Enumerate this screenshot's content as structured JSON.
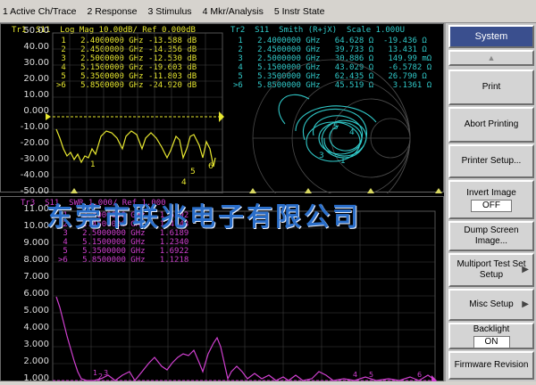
{
  "menubar": {
    "items": [
      "1 Active Ch/Trace",
      "2 Response",
      "3 Stimulus",
      "4 Mkr/Analysis",
      "5 Instr State"
    ]
  },
  "trace1": {
    "header": "Tr1  S11  Log Mag 10.00dB/ Ref 0.000dB",
    "markers": [
      " 1   2.4000000 GHz -13.588 dB",
      " 2   2.4500000 GHz -14.356 dB",
      " 3   2.5000000 GHz -12.530 dB",
      " 4   5.1500000 GHz -19.603 dB",
      " 5   5.3500000 GHz -11.803 dB",
      ">6   5.8500000 GHz -24.920 dB"
    ],
    "yticks": [
      "50.00",
      "40.00",
      "30.00",
      "20.00",
      "10.00",
      "0.000",
      "-10.00",
      "-20.00",
      "-30.00",
      "-40.00",
      "-50.00"
    ]
  },
  "trace2": {
    "header": "Tr2  S11  Smith (R+jX)  Scale 1.000U",
    "markers": [
      " 1   2.4000000 GHz   64.628 Ω  -19.436 Ω",
      " 2   2.4500000 GHz   39.733 Ω   13.431 Ω",
      " 3   2.5000000 GHz   30.886 Ω   149.99 mΩ",
      " 4   5.1500000 GHz   43.029 Ω   -6.5782 Ω",
      " 5   5.3500000 GHz   62.435 Ω   26.790 Ω",
      ">6   5.8500000 GHz   45.519 Ω    3.1361 Ω"
    ]
  },
  "trace3": {
    "header": "Tr3  S11  SWR 1.000/ Ref 1.000",
    "markers": [
      " 1   2.4000000 GHz   1.5292",
      " 2   2.4500000 GHz   1.4743",
      " 3   2.5000000 GHz   1.6189",
      " 4   5.1500000 GHz   1.2340",
      " 5   5.3500000 GHz   1.6922",
      ">6   5.8500000 GHz   1.1218"
    ],
    "yticks": [
      "11.00",
      "10.00",
      "9.000",
      "8.000",
      "7.000",
      "6.000",
      "5.000",
      "4.000",
      "3.000",
      "2.000",
      "1.000"
    ]
  },
  "softkeys": {
    "title": "System",
    "items": [
      {
        "label": "Print"
      },
      {
        "label": "Abort Printing"
      },
      {
        "label": "Printer Setup..."
      },
      {
        "label": "Invert Image",
        "value": "OFF"
      },
      {
        "label": "Dump Screen Image..."
      },
      {
        "label": "Multiport Test Set Setup"
      },
      {
        "label": "Misc Setup"
      },
      {
        "label": "Backlight",
        "value": "ON"
      },
      {
        "label": "Firmware Revision"
      }
    ]
  },
  "watermark": "东莞市联兆电子有限公司",
  "colors": {
    "trace1": "#e8e830",
    "trace2": "#30c8c8",
    "trace3": "#d040d0",
    "softkey_title": "#3a4f8e"
  }
}
